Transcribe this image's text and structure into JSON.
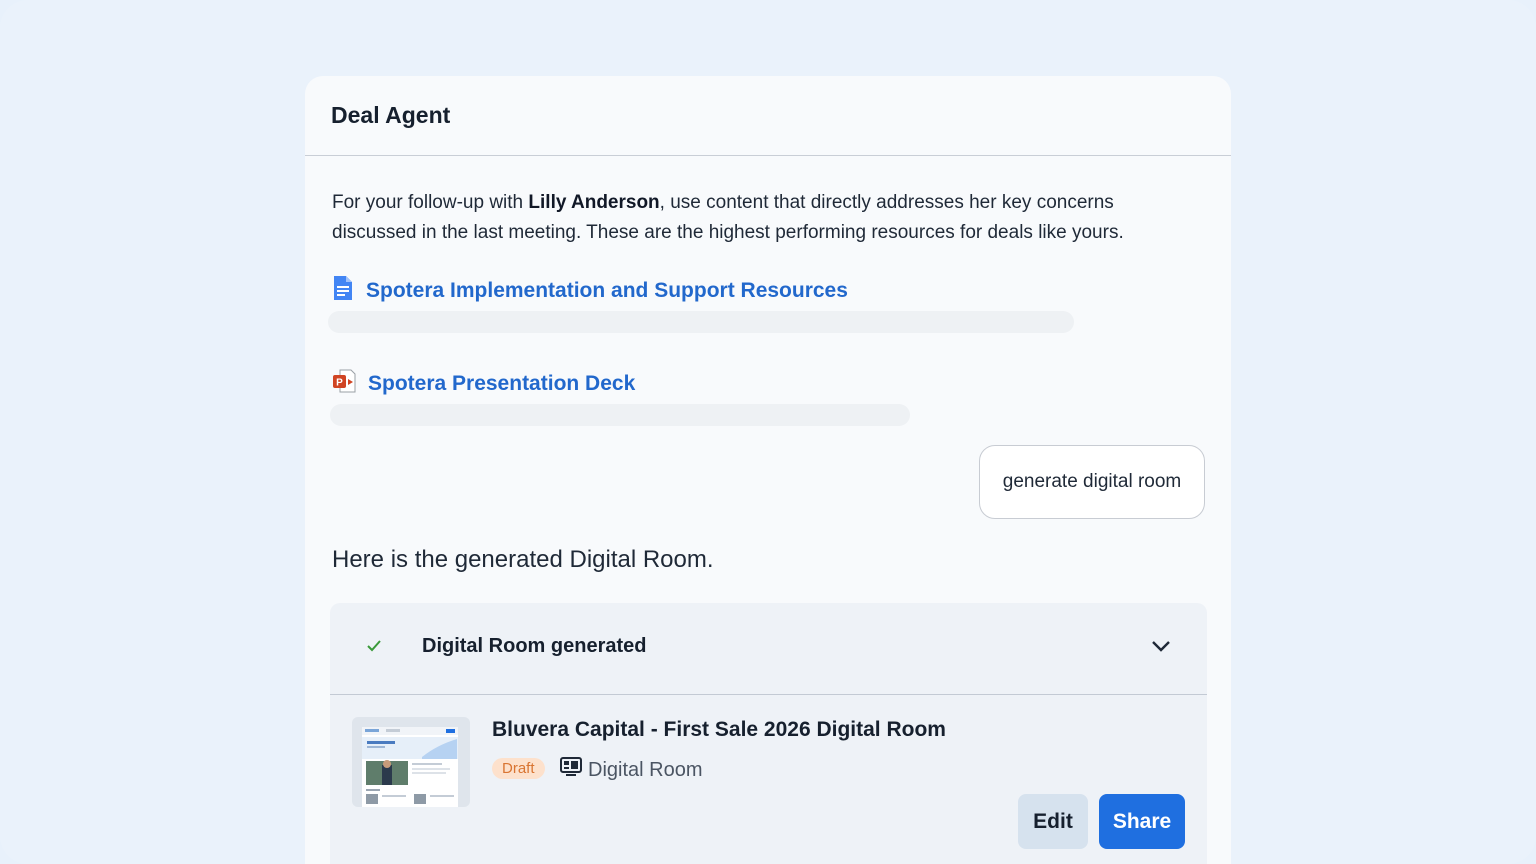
{
  "panel": {
    "title": "Deal Agent"
  },
  "intro": {
    "prefix": "For your follow-up with ",
    "name": "Lilly Anderson",
    "suffix": ", use content that directly addresses her key concerns discussed in the last meeting. These are the highest performing resources for deals like yours."
  },
  "resources": [
    {
      "label": "Spotera Implementation and Support Resources",
      "icon": "google-doc-icon",
      "color": "#4285f4"
    },
    {
      "label": "Spotera Presentation Deck",
      "icon": "powerpoint-icon",
      "color": "#d04423"
    }
  ],
  "user_message": "generate digital room",
  "agent_reply": "Here is the generated Digital Room.",
  "result": {
    "status": "Digital Room generated",
    "room_title": "Bluvera Capital - First Sale 2026 Digital Room",
    "badge": "Draft",
    "type_label": "Digital Room",
    "edit_label": "Edit",
    "share_label": "Share"
  },
  "colors": {
    "accent": "#1f6fe0",
    "link": "#2268cc",
    "check": "#3a9a3a",
    "badge_bg": "#fde1cc",
    "badge_text": "#d97532"
  }
}
